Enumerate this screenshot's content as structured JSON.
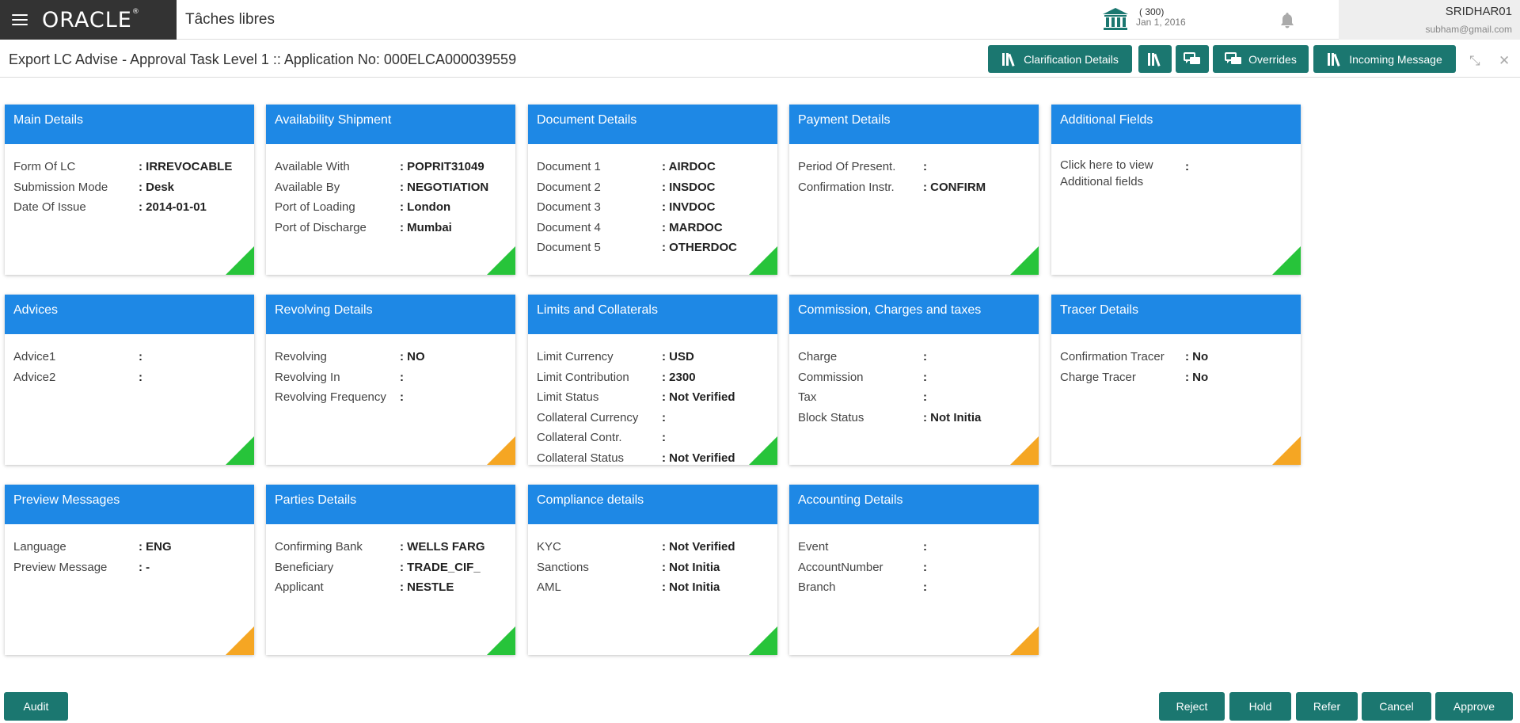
{
  "header": {
    "brand": "ORACLE",
    "app_name": "Tâches libres",
    "branch_count": "( 300)",
    "branch_date": "Jan 1, 2016",
    "user": "SRIDHAR01",
    "email": "subham@gmail.com"
  },
  "titlebar": {
    "title": "Export LC Advise - Approval Task Level 1 :: Application No: 000ELCA000039559",
    "clarification": "Clarification Details",
    "overrides": "Overrides",
    "incoming": "Incoming Message"
  },
  "cards": [
    {
      "title": "Main Details",
      "status": "green",
      "rows": [
        {
          "label": "Form Of LC",
          "value": ": IRREVOCABLE"
        },
        {
          "label": "Submission Mode",
          "value": ": Desk"
        },
        {
          "label": "Date Of Issue",
          "value": ": 2014-01-01"
        }
      ]
    },
    {
      "title": "Availability Shipment",
      "status": "green",
      "rows": [
        {
          "label": "Available With",
          "value": ": POPRIT31049"
        },
        {
          "label": "Available By",
          "value": ": NEGOTIATION"
        },
        {
          "label": "Port of Loading",
          "value": ": London"
        },
        {
          "label": "Port of Discharge",
          "value": ": Mumbai"
        }
      ]
    },
    {
      "title": "Document Details",
      "status": "green",
      "rows": [
        {
          "label": "Document 1",
          "value": ": AIRDOC"
        },
        {
          "label": "Document 2",
          "value": ": INSDOC"
        },
        {
          "label": "Document 3",
          "value": ": INVDOC"
        },
        {
          "label": "Document 4",
          "value": ": MARDOC"
        },
        {
          "label": "Document 5",
          "value": ": OTHERDOC"
        }
      ]
    },
    {
      "title": "Payment Details",
      "status": "green",
      "rows": [
        {
          "label": "Period Of Present.",
          "value": ":"
        },
        {
          "label": "Confirmation Instr.",
          "value": ": CONFIRM"
        }
      ]
    },
    {
      "title": "Additional Fields",
      "status": "green",
      "rows": [
        {
          "label": "Click here to view Additional fields",
          "value": ":"
        }
      ]
    },
    {
      "title": "Advices",
      "status": "green",
      "rows": [
        {
          "label": "Advice1",
          "value": ":"
        },
        {
          "label": "Advice2",
          "value": ":"
        }
      ]
    },
    {
      "title": "Revolving Details",
      "status": "orange",
      "rows": [
        {
          "label": "Revolving",
          "value": ": NO"
        },
        {
          "label": "Revolving In",
          "value": ":"
        },
        {
          "label": "Revolving Frequency",
          "value": ":"
        }
      ]
    },
    {
      "title": "Limits and Collaterals",
      "status": "green",
      "rows": [
        {
          "label": "Limit Currency",
          "value": ": USD"
        },
        {
          "label": "Limit Contribution",
          "value": ": 2300"
        },
        {
          "label": "Limit Status",
          "value": ": Not Verified"
        },
        {
          "label": "Collateral Currency",
          "value": ":"
        },
        {
          "label": "Collateral Contr.",
          "value": ":"
        },
        {
          "label": "Collateral Status",
          "value": ": Not Verified"
        }
      ]
    },
    {
      "title": "Commission, Charges and taxes",
      "status": "orange",
      "rows": [
        {
          "label": "Charge",
          "value": ":"
        },
        {
          "label": "Commission",
          "value": ":"
        },
        {
          "label": "Tax",
          "value": ":"
        },
        {
          "label": "Block Status",
          "value": ": Not Initia"
        }
      ]
    },
    {
      "title": "Tracer Details",
      "status": "orange",
      "rows": [
        {
          "label": "Confirmation Tracer",
          "value": ": No"
        },
        {
          "label": "Charge Tracer",
          "value": ": No"
        }
      ]
    },
    {
      "title": "Preview Messages",
      "status": "orange",
      "rows": [
        {
          "label": "Language",
          "value": ": ENG"
        },
        {
          "label": "Preview Message",
          "value": ": -"
        }
      ]
    },
    {
      "title": "Parties Details",
      "status": "green",
      "rows": [
        {
          "label": "Confirming Bank",
          "value": ": WELLS FARG"
        },
        {
          "label": "Beneficiary",
          "value": ": TRADE_CIF_"
        },
        {
          "label": "Applicant",
          "value": ": NESTLE"
        }
      ]
    },
    {
      "title": "Compliance details",
      "status": "green",
      "rows": [
        {
          "label": "KYC",
          "value": ": Not Verified"
        },
        {
          "label": "Sanctions",
          "value": ": Not Initia"
        },
        {
          "label": "AML",
          "value": ": Not Initia"
        }
      ]
    },
    {
      "title": "Accounting Details",
      "status": "orange",
      "rows": [
        {
          "label": "Event",
          "value": ":"
        },
        {
          "label": "AccountNumber",
          "value": ":"
        },
        {
          "label": "Branch",
          "value": ":"
        }
      ]
    }
  ],
  "footer": {
    "audit": "Audit",
    "reject": "Reject",
    "hold": "Hold",
    "refer": "Refer",
    "cancel": "Cancel",
    "approve": "Approve"
  },
  "colors": {
    "header_blue": "#1e88e5",
    "button_teal": "#1b7770",
    "status_green": "#27c43a",
    "status_orange": "#f5a623"
  }
}
